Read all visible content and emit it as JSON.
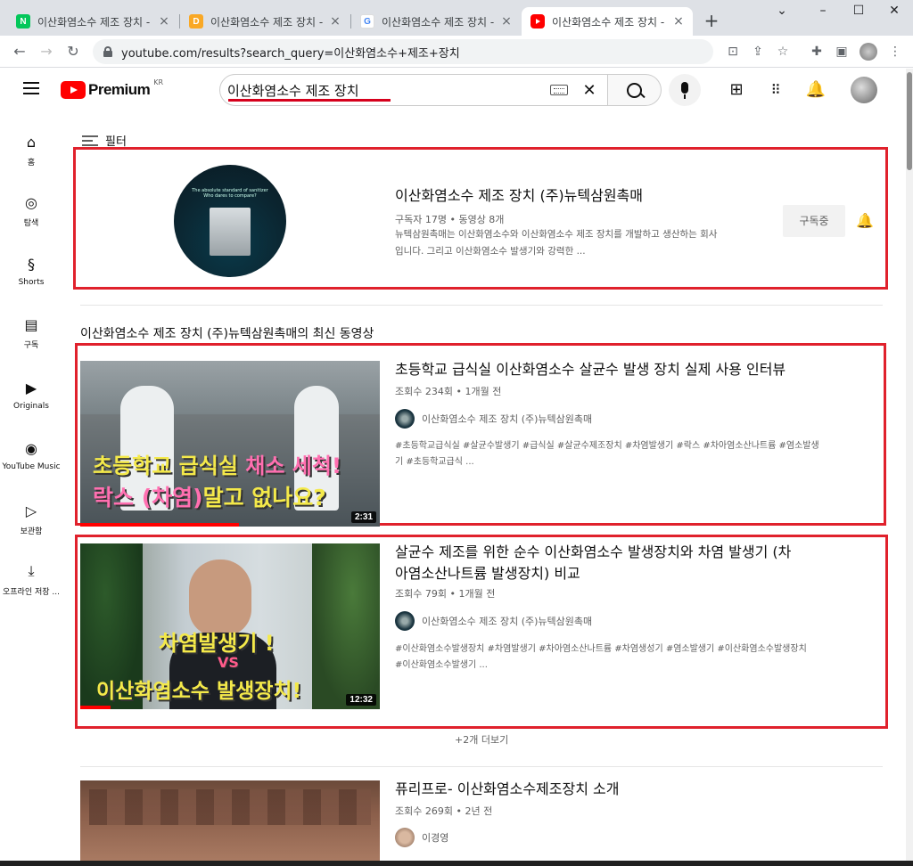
{
  "browser": {
    "tabs": [
      {
        "title": "이산화염소수 제조 장치 -",
        "favicon_letter": "N",
        "favicon_color": "#03c75a"
      },
      {
        "title": "이산화염소수 제조 장치 -",
        "favicon_letter": "D",
        "favicon_color": "#f9a825"
      },
      {
        "title": "이산화염소수 제조 장치 -",
        "favicon_letter": "G",
        "favicon_color": "#4285f4"
      },
      {
        "title": "이산화염소수 제조 장치 -",
        "favicon_letter": "",
        "favicon_color": "#ff0000"
      }
    ],
    "active_tab": 3,
    "new_tab": "+",
    "close_glyph": "×",
    "window_controls": {
      "minimize": "–",
      "maximize": "☐",
      "close": "✕",
      "menu": "⌄"
    },
    "url": "youtube.com/results?search_query=이산화염소수+제조+장치"
  },
  "youtube": {
    "logo_text": "Premium",
    "country_code": "KR",
    "search_query": "이산화염소수 제조 장치",
    "clear_glyph": "✕",
    "brand_color": "#ff0000",
    "annotation_color": "#e0212c"
  },
  "sidebar": {
    "items": [
      {
        "label": "홈",
        "icon": "home-icon"
      },
      {
        "label": "탐색",
        "icon": "compass-icon"
      },
      {
        "label": "Shorts",
        "icon": "shorts-icon"
      },
      {
        "label": "구독",
        "icon": "subscriptions-icon"
      },
      {
        "label": "Originals",
        "icon": "originals-icon"
      },
      {
        "label": "YouTube Music",
        "icon": "music-icon"
      },
      {
        "label": "보관함",
        "icon": "library-icon"
      },
      {
        "label": "오프라인 저장 ...",
        "icon": "download-icon"
      }
    ]
  },
  "filter_label": "필터",
  "channel": {
    "name": "이산화염소수 제조 장치 (주)뉴텍삼원촉매",
    "stats": "구독자 17명 • 동영상 8개",
    "description_line1": "뉴텍삼원촉매는 이산화염소수와 이산화염소수 제조 장치를 개발하고 생산하는 회사",
    "description_line2": "입니다. 그리고 이산화염소수 발생기와 강력한 ...",
    "thumb_caption_1": "The absolute standard of sanitizer",
    "thumb_caption_2": "Who dares to compare?",
    "subscribe_label": "구독중"
  },
  "shelf": {
    "title": "이산화염소수 제조 장치 (주)뉴텍삼원촉매의 최신 동영상",
    "more_label": "+2개 더보기"
  },
  "videos": [
    {
      "title": "초등학교 급식실 이산화염소수 살균수 발생 장치 실제 사용 인터뷰",
      "meta": "조회수 234회 • 1개월 전",
      "channel": "이산화염소수 제조 장치 (주)뉴텍삼원촉매",
      "tags_line1": "#초등학교급식실 #살균수발생기 #급식실 #살균수제조장치 #차염발생기 #락스 #차아염소산나트륨 #염소발생",
      "tags_line2": "기 #초등학교급식 ...",
      "duration": "2:31",
      "watched_fraction": 0.53,
      "overlay_line1a": "초등학교 급식실 ",
      "overlay_line1b": "채소 세척!",
      "overlay_line2a": "락스 (차염)",
      "overlay_line2b": "말고 없나요?"
    },
    {
      "title_line1": "살균수 제조를 위한 순수 이산화염소수 발생장치와 차염 발생기 (차",
      "title_line2": "아염소산나트륨 발생장치) 비교",
      "meta": "조회수 79회 • 1개월 전",
      "channel": "이산화염소수 제조 장치 (주)뉴텍삼원촉매",
      "tags_line1": "#이산화염소수발생장치 #차염발생기 #차아염소산나트륨 #차염생성기 #염소발생기 #이산화염소수발생장치",
      "tags_line2": "#이산화염소수발생기 ...",
      "duration": "12:32",
      "watched_fraction": 0.1,
      "overlay_line1": "차염발생기 !",
      "overlay_vs": "VS",
      "overlay_line2": "이산화염소수 발생장치!"
    },
    {
      "title": "퓨리프로- 이산화염소수제조장치 소개",
      "meta": "조회수 269회 • 2년 전",
      "channel": "이경영"
    }
  ]
}
